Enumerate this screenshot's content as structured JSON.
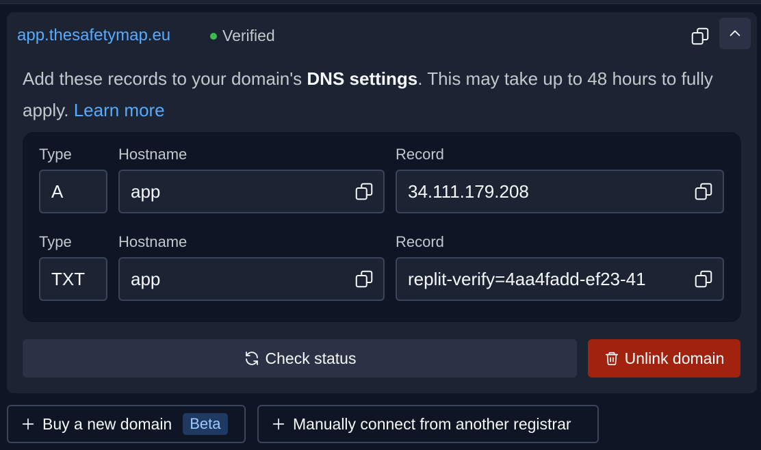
{
  "domain": {
    "name": "app.thesafetymap.eu",
    "status": "Verified",
    "status_color": "#3fb950"
  },
  "description": {
    "prefix": "Add these records to your domain's ",
    "bold": "DNS settings",
    "suffix": ". This may take up to 48 hours to fully apply. ",
    "link": "Learn more"
  },
  "records": [
    {
      "type_label": "Type",
      "hostname_label": "Hostname",
      "record_label": "Record",
      "type": "A",
      "hostname": "app",
      "record": "34.111.179.208"
    },
    {
      "type_label": "Type",
      "hostname_label": "Hostname",
      "record_label": "Record",
      "type": "TXT",
      "hostname": "app",
      "record": "replit-verify=4aa4fadd-ef23-41"
    }
  ],
  "actions": {
    "check_status": "Check status",
    "unlink": "Unlink domain",
    "unlink_color": "#a0220f"
  },
  "bottom": {
    "buy": "Buy a new domain",
    "beta": "Beta",
    "manual": "Manually connect from another registrar"
  },
  "icons": [
    "copy-icon",
    "chevron-up-icon",
    "refresh-icon",
    "trash-icon",
    "plus-icon"
  ],
  "colors": {
    "accent": "#57abff",
    "background": "#0e1525",
    "surface": "#1c2333"
  }
}
